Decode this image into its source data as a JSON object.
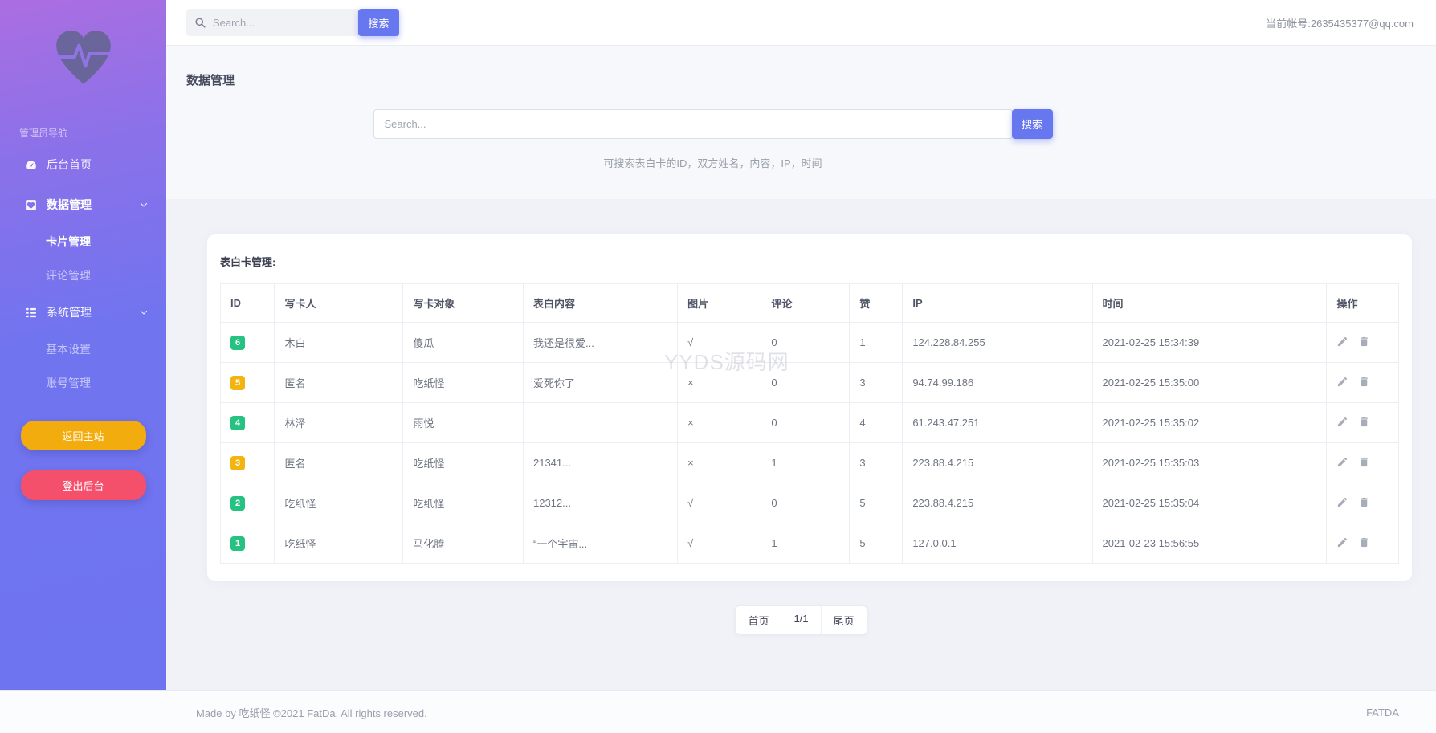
{
  "sidebar": {
    "nav_label": "管理员导航",
    "menu_home": "后台首页",
    "menu_data": "数据管理",
    "sub_cards": "卡片管理",
    "sub_comments": "评论管理",
    "menu_system": "系统管理",
    "sub_settings": "基本设置",
    "sub_accounts": "账号管理",
    "btn_main_site": "返回主站",
    "btn_logout": "登出后台"
  },
  "topbar": {
    "search_placeholder": "Search...",
    "search_button": "搜索",
    "account": "当前帐号:2635435377@qq.com"
  },
  "page": {
    "title": "数据管理",
    "search_placeholder": "Search...",
    "search_button": "搜索",
    "search_hint": "可搜索表白卡的ID，双方姓名，内容，IP，时间"
  },
  "card": {
    "title": "表白卡管理:",
    "table": {
      "headers": [
        "ID",
        "写卡人",
        "写卡对象",
        "表白内容",
        "图片",
        "评论",
        "赞",
        "IP",
        "时间",
        "操作"
      ],
      "rows": [
        {
          "id": "6",
          "id_color": "green",
          "writer": "木白",
          "target": "傻瓜",
          "content": "我还是很爱...",
          "image": "√",
          "comments": "0",
          "likes": "1",
          "ip": "124.228.84.255",
          "time": "2021-02-25 15:34:39"
        },
        {
          "id": "5",
          "id_color": "yellow",
          "writer": "匿名",
          "target": "吃纸怪",
          "content": "爱死你了",
          "image": "×",
          "comments": "0",
          "likes": "3",
          "ip": "94.74.99.186",
          "time": "2021-02-25 15:35:00"
        },
        {
          "id": "4",
          "id_color": "green",
          "writer": "林泽",
          "target": "雨悦",
          "content": "",
          "image": "×",
          "comments": "0",
          "likes": "4",
          "ip": "61.243.47.251",
          "time": "2021-02-25 15:35:02"
        },
        {
          "id": "3",
          "id_color": "yellow",
          "writer": "匿名",
          "target": "吃纸怪",
          "content": "21341...",
          "image": "×",
          "comments": "1",
          "likes": "3",
          "ip": "223.88.4.215",
          "time": "2021-02-25 15:35:03"
        },
        {
          "id": "2",
          "id_color": "green",
          "writer": "吃纸怪",
          "target": "吃纸怪",
          "content": "12312...",
          "image": "√",
          "comments": "0",
          "likes": "5",
          "ip": "223.88.4.215",
          "time": "2021-02-25 15:35:04"
        },
        {
          "id": "1",
          "id_color": "green",
          "writer": "吃纸怪",
          "target": "马化腾",
          "content": "“一个宇宙...",
          "image": "√",
          "comments": "1",
          "likes": "5",
          "ip": "127.0.0.1",
          "time": "2021-02-23 15:56:55"
        }
      ]
    }
  },
  "pagination": {
    "first": "首页",
    "current": "1/1",
    "last": "尾页"
  },
  "watermark": "YYDS源码网",
  "footer": {
    "left": "Made by 吃纸怪 ©2021 FatDa. All rights reserved.",
    "right": "FATDA"
  },
  "colors": {
    "accent": "#6777ef",
    "badge_green": "#26c281",
    "badge_yellow": "#f2b50f",
    "sidebar_gradient_top": "#ab6ee1",
    "sidebar_gradient_bottom": "#6e73f0",
    "btn_main_site": "#f3ac0d",
    "btn_logout": "#f4506c"
  }
}
